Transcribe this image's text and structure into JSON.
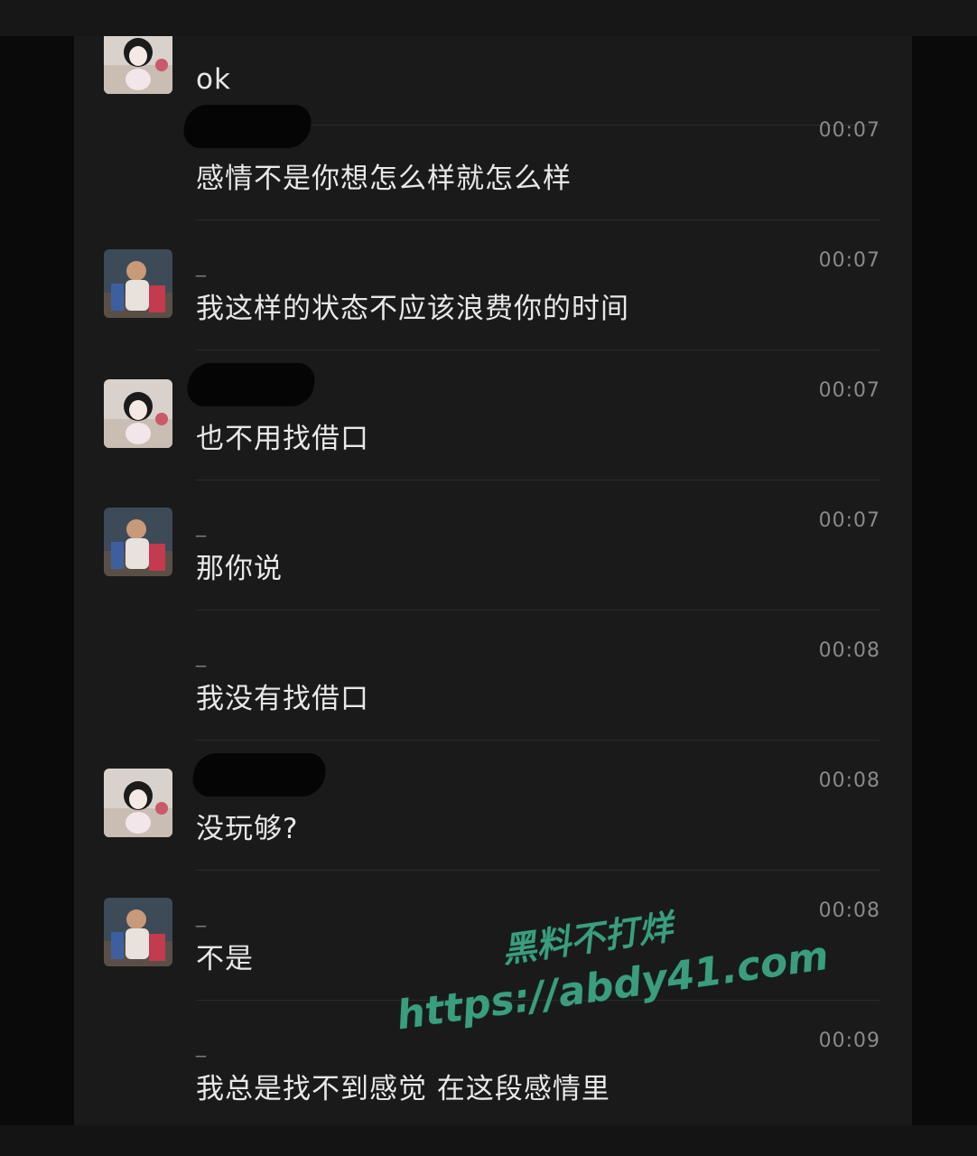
{
  "messages": [
    {
      "sender_avatar": "girl-avatar",
      "name": "",
      "time": "",
      "text": "ok"
    },
    {
      "sender_avatar": "none",
      "name": "",
      "time": "00:07",
      "text": "感情不是你想怎么样就怎么样"
    },
    {
      "sender_avatar": "guy-avatar",
      "name": "_",
      "time": "00:07",
      "text": "我这样的状态不应该浪费你的时间"
    },
    {
      "sender_avatar": "girl-avatar",
      "name": "",
      "time": "00:07",
      "text": "也不用找借口"
    },
    {
      "sender_avatar": "guy-avatar",
      "name": "_",
      "time": "00:07",
      "text": "那你说"
    },
    {
      "sender_avatar": "none",
      "name": "_",
      "time": "00:08",
      "text": "我没有找借口"
    },
    {
      "sender_avatar": "girl-avatar",
      "name": "",
      "time": "00:08",
      "text": "没玩够?"
    },
    {
      "sender_avatar": "guy-avatar",
      "name": "_",
      "time": "00:08",
      "text": "不是"
    },
    {
      "sender_avatar": "none",
      "name": "_",
      "time": "00:09",
      "text": "我总是找不到感觉 在这段感情里"
    }
  ],
  "watermark": {
    "line1": "黑料不打烊",
    "line2": "https://abdy41.com",
    "color": "#3b9d7e"
  }
}
